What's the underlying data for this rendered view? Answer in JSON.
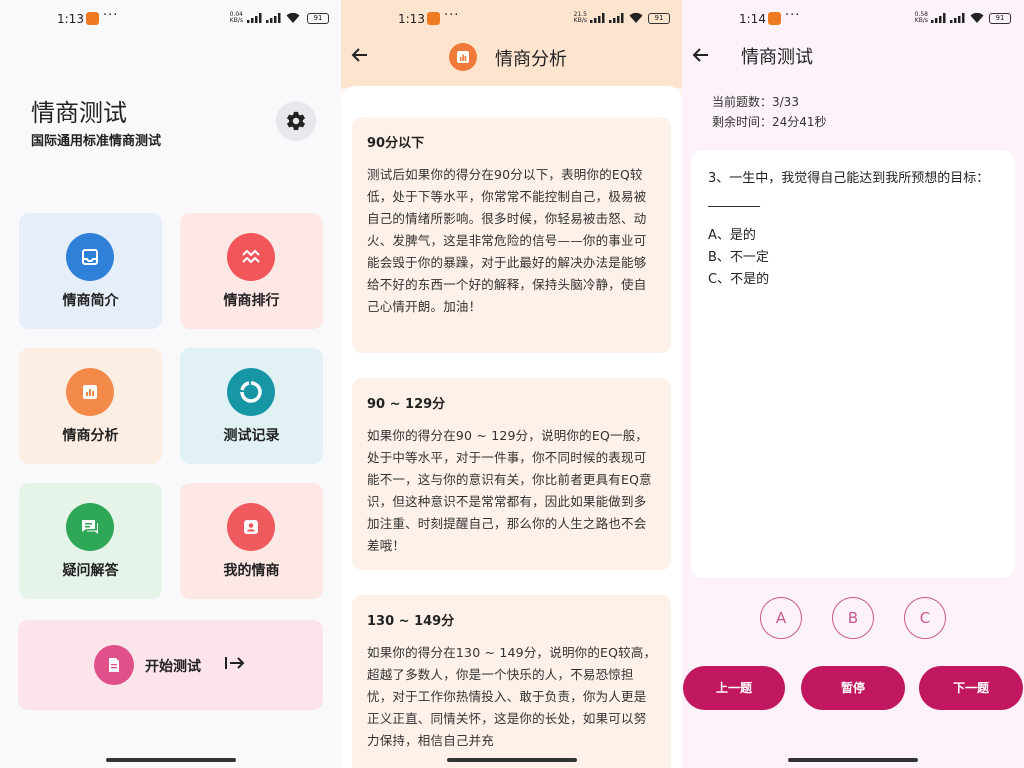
{
  "home": {
    "status": {
      "time": "1:13",
      "speed": "0.04 KB/s",
      "battery": "91"
    },
    "title": "情商测试",
    "subtitle": "国际通用标准情商测试",
    "tiles": [
      {
        "label": "情商简介",
        "icon": "inbox-icon",
        "color": "#2f80d9",
        "bg": "#e6eff9"
      },
      {
        "label": "情商排行",
        "icon": "trend-icon",
        "color": "#f2555a",
        "bg": "#fde8e6"
      },
      {
        "label": "情商分析",
        "icon": "chart-icon",
        "color": "#f38a4a",
        "bg": "#fdeee3"
      },
      {
        "label": "测试记录",
        "icon": "donut-icon",
        "color": "#1797a6",
        "bg": "#e2f2f4"
      },
      {
        "label": "疑问解答",
        "icon": "chat-icon",
        "color": "#2ea756",
        "bg": "#e6f3e9"
      },
      {
        "label": "我的情商",
        "icon": "person-icon",
        "color": "#ee5a5e",
        "bg": "#fde8e6"
      }
    ],
    "start": {
      "label": "开始测试",
      "arrow": "I→"
    }
  },
  "analysis": {
    "status": {
      "time": "1:13",
      "speed": "21.5 KB/s",
      "battery": "91"
    },
    "title": "情商分析",
    "cards": [
      {
        "heading": "90分以下",
        "text": "测试后如果你的得分在90分以下，表明你的EQ较低，处于下等水平，你常常不能控制自己，极易被自己的情绪所影响。很多时候，你轻易被击怒、动火、发脾气，这是非常危险的信号——你的事业可能会毁于你的暴躁，对于此最好的解决办法是能够给不好的东西一个好的解释，保持头脑冷静，使自己心情开朗。加油！"
      },
      {
        "heading": "90 ~ 129分",
        "text": "如果你的得分在90 ~ 129分，说明你的EQ一般，处于中等水平，对于一件事，你不同时候的表现可能不一，这与你的意识有关，你比前者更具有EQ意识，但这种意识不是常常都有，因此如果能做到多加注重、时刻提醒自己，那么你的人生之路也不会差哦！"
      },
      {
        "heading": "130 ~ 149分",
        "text": "如果你的得分在130 ~ 149分，说明你的EQ较高，超越了多数人，你是一个快乐的人，不易恐惊担忧，对于工作你热情投入、敢于负责，你为人更是正义正直、同情关怀，这是你的长处，如果可以努力保持，相信自己并充"
      }
    ]
  },
  "quiz": {
    "status": {
      "time": "1:14",
      "speed": "0.58 KB/s",
      "battery": "91"
    },
    "title": "情商测试",
    "progress": "当前题数：3/33",
    "remaining": "剩余时间：24分41秒",
    "question": "3、一生中，我觉得自己能达到我所预想的目标：________",
    "options": [
      "A、是的",
      "B、不一定",
      "C、不是的"
    ],
    "choices": [
      "A",
      "B",
      "C"
    ],
    "buttons": {
      "prev": "上一题",
      "pause": "暂停",
      "next": "下一题"
    }
  }
}
